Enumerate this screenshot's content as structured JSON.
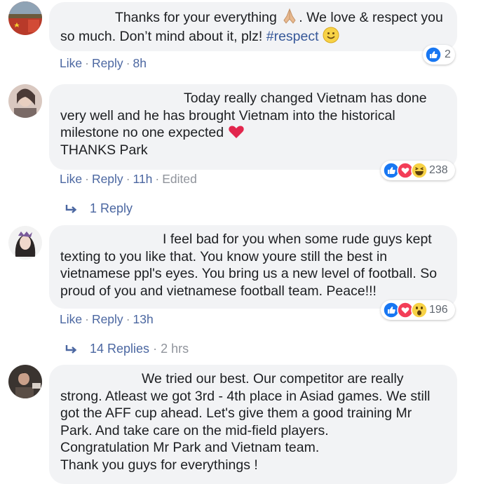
{
  "comments": [
    {
      "text_before": "Thanks for your everything",
      "text_after": ". We love & respect you so much. Don’t mind about it, plz!",
      "hashtag": "#respect",
      "actions": {
        "like": "Like",
        "reply": "Reply",
        "time": "8h"
      },
      "reactions": {
        "count": "2",
        "icons": [
          "like-icon"
        ]
      }
    },
    {
      "text": "Today really changed Vietnam has done very well and he has brought Vietnam into the historical milestone no one expected",
      "text_line2": "THANKS Park",
      "actions": {
        "like": "Like",
        "reply": "Reply",
        "time": "11h",
        "edited": "Edited"
      },
      "reactions": {
        "count": "238",
        "icons": [
          "like-icon",
          "love-icon",
          "haha-icon"
        ]
      },
      "replies": {
        "label": "1 Reply"
      }
    },
    {
      "text": "I feel bad for you when some rude guys kept texting to you like that. You know youre still the best in vietnamese ppl's eyes. You bring us a new level of football. So proud of you and vietnamese football team. Peace!!!",
      "actions": {
        "like": "Like",
        "reply": "Reply",
        "time": "13h"
      },
      "reactions": {
        "count": "196",
        "icons": [
          "like-icon",
          "love-icon",
          "wow-icon"
        ]
      },
      "replies": {
        "label": "14 Replies",
        "time": "2 hrs"
      }
    },
    {
      "text": "We tried our best. Our competitor are really strong. Atleast we got 3rd - 4th place in Asiad games. We still got the AFF cup ahead. Let's give them a good training Mr Park. And take care on the mid-field players.",
      "text_line2": "Congratulation Mr Park and Vietnam team.",
      "text_line3": "Thank you guys for everythings !"
    }
  ],
  "separator": "·",
  "colors": {
    "bubble": "#f2f3f5",
    "link": "#4b67a1",
    "hashtag": "#365899",
    "meta": "#90949c",
    "like_blue": "#1877f2",
    "love_red": "#f33e58",
    "yellow": "#f7d246"
  }
}
